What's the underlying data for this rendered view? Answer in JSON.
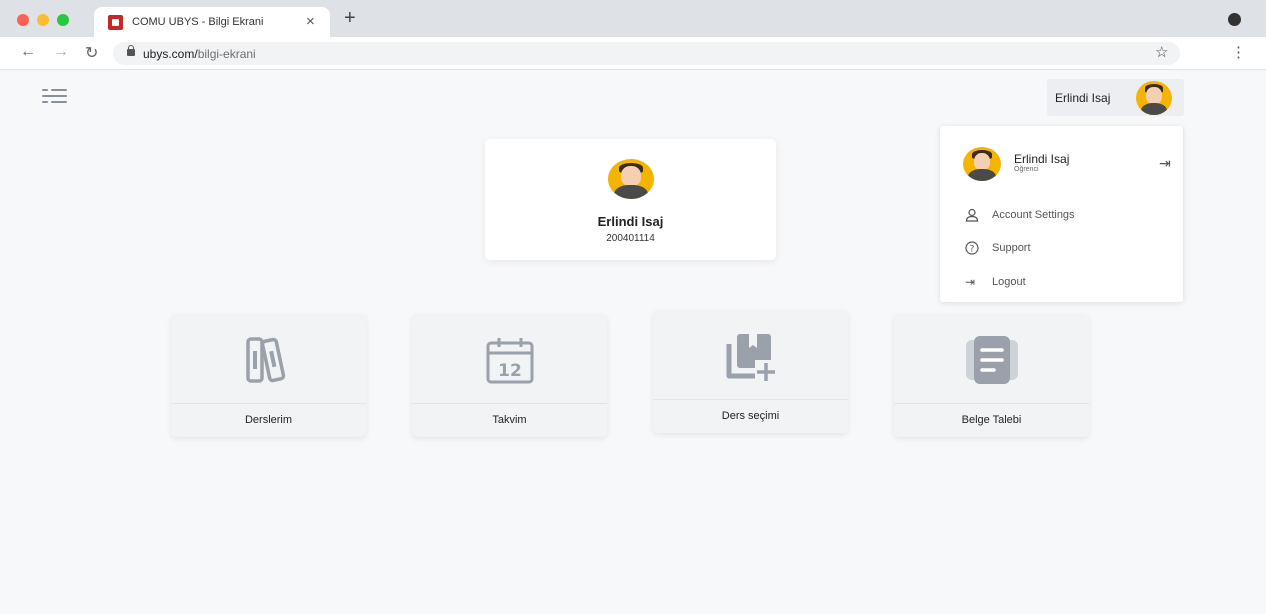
{
  "browser": {
    "tab_title": "COMU UBYS - Bilgi Ekrani",
    "tab_close": "×",
    "new_tab": "+",
    "url_host": "ubys.com/",
    "url_path": "bilgi-ekrani",
    "icons": [
      "back-icon",
      "forward-icon",
      "reload-icon",
      "lock-icon",
      "star-icon",
      "kebab-menu-icon"
    ]
  },
  "header": {
    "user_name": "Erlindi Isaj"
  },
  "dropdown": {
    "name": "Erlindi Isaj",
    "role": "Öğrenci",
    "items": [
      {
        "label": "Account Settings",
        "icon": "user-icon"
      },
      {
        "label": "Support",
        "icon": "question-icon"
      },
      {
        "label": "Logout",
        "icon": "logout-icon"
      }
    ]
  },
  "profile": {
    "name": "Erlindi Isaj",
    "student_id": "200401114"
  },
  "tiles": [
    {
      "label": "Derslerim",
      "icon": "books-icon"
    },
    {
      "label": "Takvim",
      "icon": "calendar-icon",
      "icon_text": "12"
    },
    {
      "label": "Ders seçimi",
      "icon": "add-bookmark-icon"
    },
    {
      "label": "Belge Talebi",
      "icon": "document-icon"
    }
  ],
  "colors": {
    "avatar_bg": "#f4b400",
    "icon_gray": "#9aa1aa",
    "page_bg": "#f7f8fa"
  }
}
